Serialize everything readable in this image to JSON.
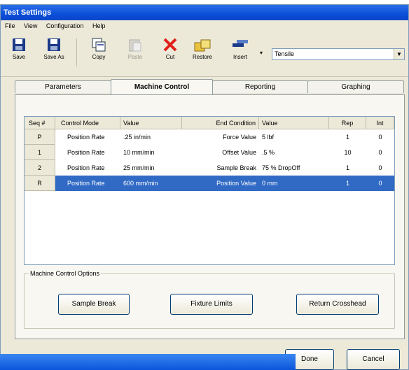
{
  "window": {
    "title": "Test Settings"
  },
  "menu": [
    "File",
    "View",
    "Configuration",
    "Help"
  ],
  "toolbar": {
    "save": "Save",
    "save_as": "Save As",
    "copy": "Copy",
    "paste": "Paste",
    "cut": "Cut",
    "restore": "Restore",
    "insert": "Insert",
    "dropdown_value": "Tensile"
  },
  "tabs": [
    "Parameters",
    "Machine Control",
    "Reporting",
    "Graphing"
  ],
  "active_tab": "Machine Control",
  "grid": {
    "columns": [
      "Seq #",
      "Control Mode",
      "Value",
      "End Condition",
      "Value",
      "Rep",
      "Int"
    ],
    "rows": [
      {
        "seq": "P",
        "mode": "Position Rate",
        "value": ".25 in/min",
        "end": "Force Value",
        "end_value": "5 lbf",
        "rep": "1",
        "int": "0"
      },
      {
        "seq": "1",
        "mode": "Position Rate",
        "value": "10 mm/min",
        "end": "Offset Value",
        "end_value": ".5 %",
        "rep": "10",
        "int": "0"
      },
      {
        "seq": "2",
        "mode": "Position Rate",
        "value": "25 mm/min",
        "end": "Sample Break",
        "end_value": "75 % DropOff",
        "rep": "1",
        "int": "0"
      },
      {
        "seq": "R",
        "mode": "Position Rate",
        "value": "600 mm/min",
        "end": "Position Value",
        "end_value": "0 mm",
        "rep": "1",
        "int": "0"
      }
    ]
  },
  "options": {
    "legend": "Machine Control Options",
    "sample_break": "Sample Break",
    "fixture_limits": "Fixture Limits",
    "return_crosshead": "Return Crosshead"
  },
  "footer": {
    "done": "Done",
    "cancel": "Cancel"
  }
}
